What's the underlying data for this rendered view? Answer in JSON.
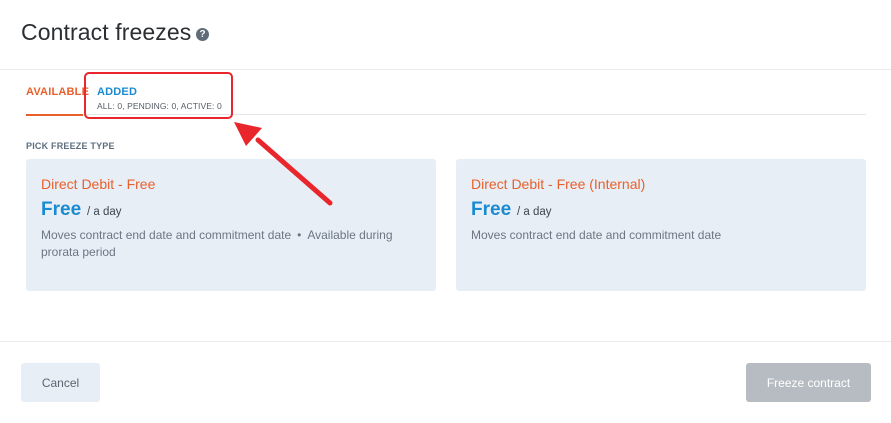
{
  "header": {
    "title": "Contract freezes",
    "help_icon": "?"
  },
  "tabs": {
    "available": {
      "label": "AVAILABLE"
    },
    "added": {
      "label": "ADDED",
      "counts": "ALL: 0, PENDING: 0, ACTIVE: 0"
    }
  },
  "section": {
    "label": "PICK FREEZE TYPE"
  },
  "cards": [
    {
      "title": "Direct Debit - Free",
      "price": "Free",
      "unit": "/ a day",
      "desc_main": "Moves contract end date and commitment date",
      "desc_bullet": "•",
      "desc_extra": "Available during prorata period"
    },
    {
      "title": "Direct Debit - Free (Internal)",
      "price": "Free",
      "unit": "/ a day",
      "desc_main": "Moves contract end date and commitment date"
    }
  ],
  "footer": {
    "cancel_label": "Cancel",
    "freeze_label": "Freeze contract"
  },
  "colors": {
    "accent_orange": "#e8602c",
    "accent_blue": "#1a8bd0",
    "annotation_red": "#e8262b",
    "card_bg": "#e8eef6",
    "disabled_button": "#b7bcc2"
  }
}
